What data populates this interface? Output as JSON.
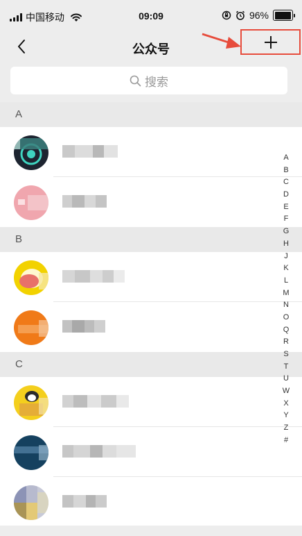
{
  "status_bar": {
    "carrier": "中国移动",
    "time": "09:09",
    "battery": "96%",
    "battery_level": 0.96
  },
  "navbar": {
    "title": "公众号",
    "back_icon": "chevron-left-icon",
    "add_icon": "plus-icon"
  },
  "search": {
    "placeholder": "搜索",
    "icon": "search-icon"
  },
  "sections": [
    {
      "letter": "A"
    },
    {
      "letter": "B"
    },
    {
      "letter": "C"
    }
  ],
  "index_letters": [
    "A",
    "B",
    "C",
    "D",
    "E",
    "F",
    "G",
    "H",
    "J",
    "K",
    "L",
    "M",
    "N",
    "O",
    "Q",
    "R",
    "S",
    "T",
    "U",
    "W",
    "X",
    "Y",
    "Z",
    "#"
  ],
  "colors": {
    "accent_box": "#e74c3c",
    "background": "#ededed"
  }
}
